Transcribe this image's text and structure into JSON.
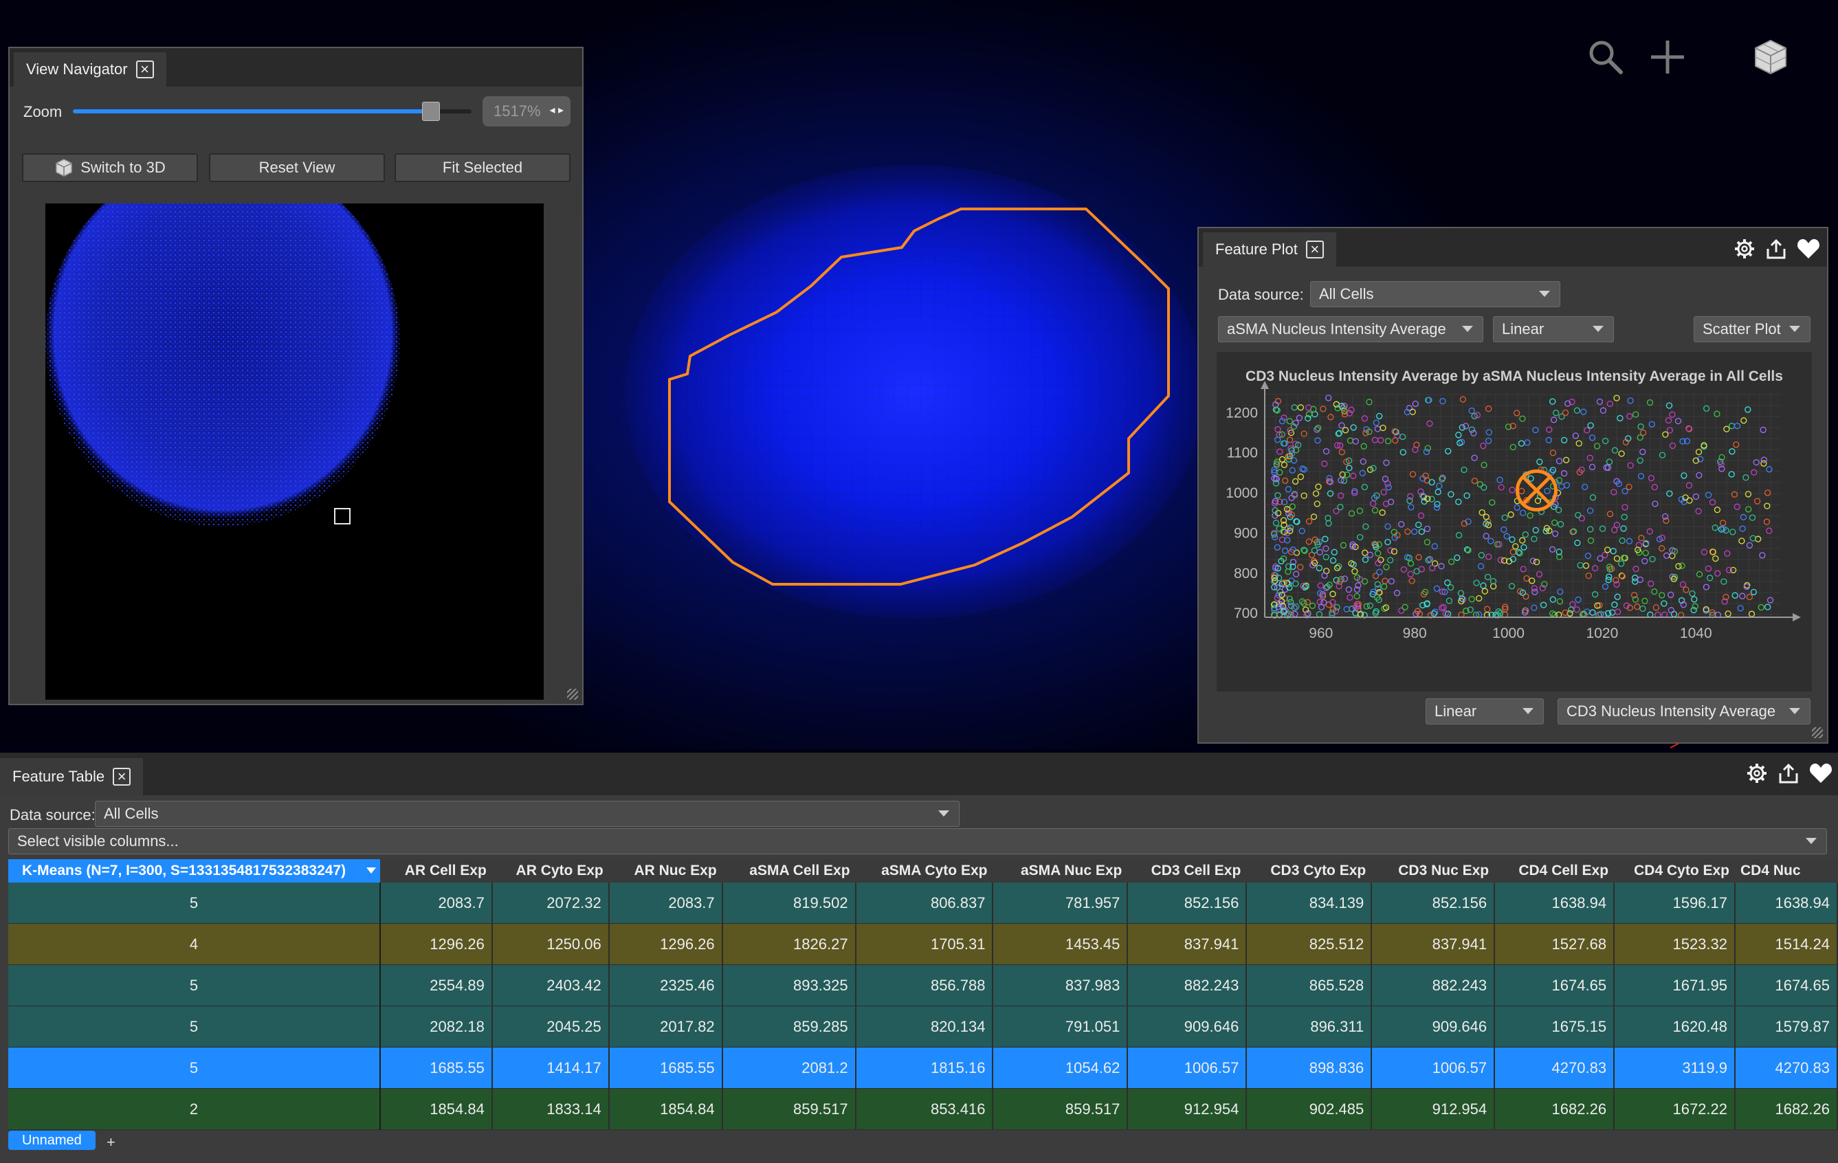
{
  "view_navigator": {
    "tab_label": "View Navigator",
    "zoom_label": "Zoom",
    "zoom_value": "1517%",
    "zoom_slider_fraction": 0.9,
    "switch_3d": "Switch to 3D",
    "reset_view": "Reset View",
    "fit_selected": "Fit Selected"
  },
  "feature_plot": {
    "tab_label": "Feature Plot",
    "data_source_label": "Data source:",
    "data_source_value": "All Cells",
    "x_feature": "aSMA Nucleus Intensity Average",
    "x_scale": "Linear",
    "plot_type": "Scatter Plot",
    "y_scale": "Linear",
    "y_feature": "CD3 Nucleus Intensity Average"
  },
  "chart_data": {
    "type": "scatter",
    "title": "CD3 Nucleus Intensity Average by aSMA Nucleus Intensity Average in All Cells",
    "xlabel": "",
    "ylabel": "",
    "xlim": [
      948,
      1058
    ],
    "ylim": [
      690,
      1245
    ],
    "x_ticks": [
      960,
      980,
      1000,
      1020,
      1040
    ],
    "y_ticks": [
      700,
      800,
      900,
      1000,
      1100,
      1200
    ],
    "grid": true,
    "selected_point": {
      "x": 1006,
      "y": 1006
    },
    "marker_colors": [
      "#c040c0",
      "#40c040",
      "#4080ff",
      "#e0e040",
      "#40e0e0",
      "#e06030",
      "#a070ff",
      "#30c090"
    ],
    "n_points": 900
  },
  "feature_table": {
    "tab_label": "Feature Table",
    "data_source_label": "Data source:",
    "data_source_value": "All Cells",
    "columns_placeholder": "Select visible columns...",
    "columns": [
      "K-Means (N=7, I=300, S=1331354817532383247)",
      "AR Cell Exp",
      "AR Cyto Exp",
      "AR Nuc Exp",
      "aSMA Cell Exp",
      "aSMA Cyto Exp",
      "aSMA Nuc Exp",
      "CD3 Cell Exp",
      "CD3 Cyto Exp",
      "CD3 Nuc Exp",
      "CD4 Cell Exp",
      "CD4 Cyto Exp",
      "CD4 Nuc"
    ],
    "rows": [
      {
        "color": "#235c5a",
        "cells": [
          "5",
          "2083.7",
          "2072.32",
          "2083.7",
          "819.502",
          "806.837",
          "781.957",
          "852.156",
          "834.139",
          "852.156",
          "1638.94",
          "1596.17",
          "1638.94"
        ]
      },
      {
        "color": "#5c5620",
        "cells": [
          "4",
          "1296.26",
          "1250.06",
          "1296.26",
          "1826.27",
          "1705.31",
          "1453.45",
          "837.941",
          "825.512",
          "837.941",
          "1527.68",
          "1523.32",
          "1514.24"
        ]
      },
      {
        "color": "#235c5a",
        "cells": [
          "5",
          "2554.89",
          "2403.42",
          "2325.46",
          "893.325",
          "856.788",
          "837.983",
          "882.243",
          "865.528",
          "882.243",
          "1674.65",
          "1671.95",
          "1674.65"
        ]
      },
      {
        "color": "#235c5a",
        "cells": [
          "5",
          "2082.18",
          "2045.25",
          "2017.82",
          "859.285",
          "820.134",
          "791.051",
          "909.646",
          "896.311",
          "909.646",
          "1675.15",
          "1620.48",
          "1579.87"
        ]
      },
      {
        "color": "#1f8bff",
        "cells": [
          "5",
          "1685.55",
          "1414.17",
          "1685.55",
          "2081.2",
          "1815.16",
          "1054.62",
          "1006.57",
          "898.836",
          "1006.57",
          "4270.83",
          "3119.9",
          "4270.83"
        ]
      },
      {
        "color": "#24542a",
        "cells": [
          "2",
          "1854.84",
          "1833.14",
          "1854.84",
          "859.517",
          "853.416",
          "859.517",
          "912.954",
          "902.485",
          "912.954",
          "1682.26",
          "1672.22",
          "1682.26"
        ]
      }
    ],
    "sheet_tab": "Unnamed",
    "add_sheet": "+"
  }
}
